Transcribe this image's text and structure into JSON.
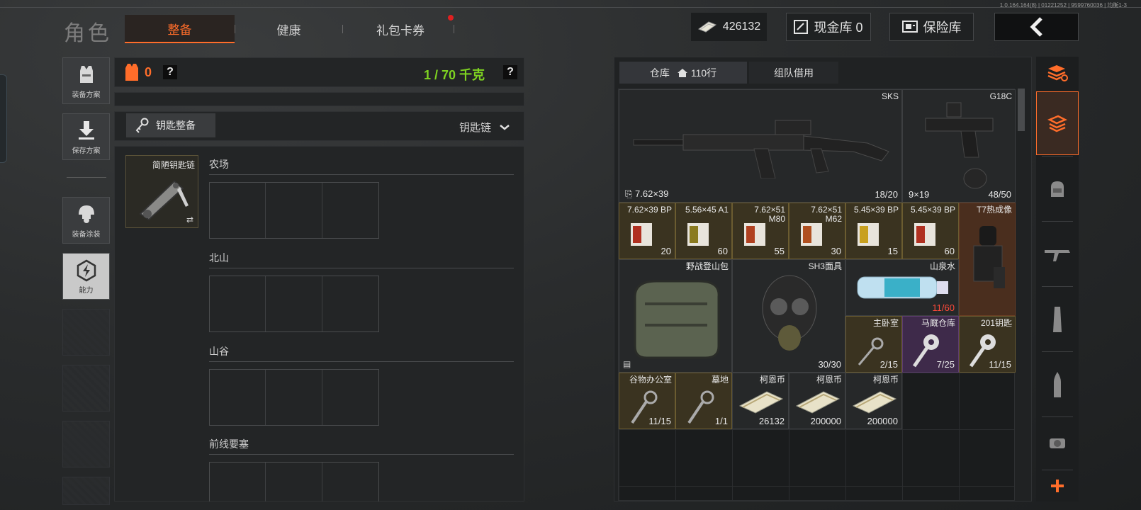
{
  "version": "1.0.164.164(8) | 01221252 | 9599760036 | 均衡1-3",
  "header": {
    "title": "角色",
    "tabs": [
      {
        "label": "整备",
        "active": true
      },
      {
        "label": "健康",
        "active": false
      },
      {
        "label": "礼包卡券",
        "active": false,
        "badge": true
      }
    ],
    "cash": "426132",
    "cash_vault": "现金库 0",
    "safe": "保险库"
  },
  "rail": {
    "loadout": "装备方案",
    "save": "保存方案",
    "paint": "装备涂装",
    "ability": "能力"
  },
  "equip": {
    "armor_count": "0",
    "help": "?",
    "weight": "1 / 70 千克",
    "keychain_tab": "钥匙整备",
    "dropdown": "钥匙链",
    "keychain_slot": "简陋钥匙链",
    "zones": [
      "农场",
      "北山",
      "山谷",
      "前线要塞"
    ]
  },
  "warehouse": {
    "tab_storage": "仓库",
    "rows": "110行",
    "tab_team": "组队借用",
    "items": {
      "sks": {
        "name": "SKS",
        "caliber": "7.62×39",
        "count": "18/20"
      },
      "g18c": {
        "name": "G18C",
        "caliber": "9×19",
        "count": "48/50"
      },
      "ammo": [
        {
          "name": "7.62×39 BP",
          "count": "20"
        },
        {
          "name": "5.56×45 A1",
          "count": "60"
        },
        {
          "name": "7.62×51 M80",
          "count": "55"
        },
        {
          "name": "7.62×51 M62",
          "count": "30"
        },
        {
          "name": "5.45×39 BP",
          "count": "15"
        },
        {
          "name": "5.45×39 BP",
          "count": "60"
        }
      ],
      "t7": {
        "name": "T7热成像"
      },
      "backpack": {
        "name": "野战登山包"
      },
      "mask": {
        "name": "SH3面具",
        "count": "30/30"
      },
      "water": {
        "name": "山泉水",
        "count": "11/60"
      },
      "keys": [
        {
          "name": "主卧室",
          "count": "2/15"
        },
        {
          "name": "马厩仓库",
          "count": "7/25"
        },
        {
          "name": "201钥匙",
          "count": "11/15"
        },
        {
          "name": "谷物办公室",
          "count": "11/15"
        },
        {
          "name": "墓地",
          "count": "1/1"
        }
      ],
      "coins": [
        {
          "name": "柯恩币",
          "count": "26132"
        },
        {
          "name": "柯恩币",
          "count": "200000"
        },
        {
          "name": "柯恩币",
          "count": "200000"
        }
      ]
    }
  },
  "categories": [
    "all-icon",
    "equipment-icon",
    "backpack-icon",
    "rifle-icon",
    "magazine-icon",
    "ammo-icon",
    "scope-icon",
    "add-icon"
  ],
  "colors": {
    "accent": "#ff6d2a",
    "weight": "#7ed321",
    "gold_item": "#3a3320",
    "purple_item": "#3e2a4a"
  }
}
